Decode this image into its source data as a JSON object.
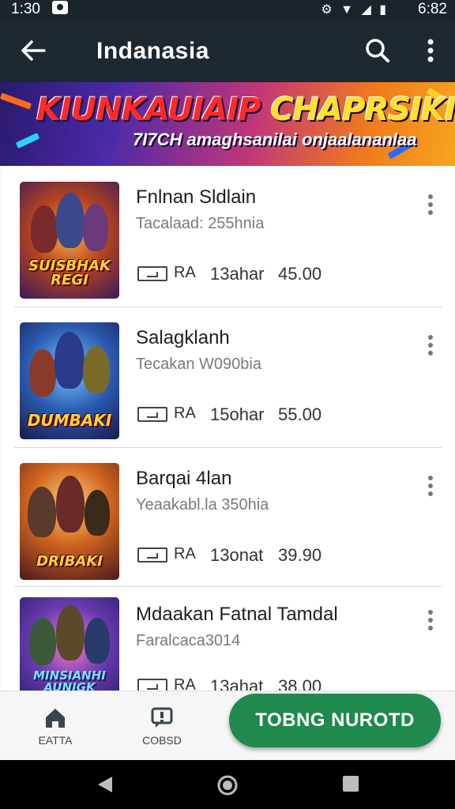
{
  "status_bar": {
    "time": "1:30",
    "system_icons": "⚙ ▼ ◢ ▮",
    "battery_time": "6:82"
  },
  "app_bar": {
    "title": "Indanasia"
  },
  "banner": {
    "headline_red": "KIUNKAUIAIP ",
    "headline_yellow": "CHAPRSIKI",
    "subline": "7I7CH amaghsanilai onjaalananlaa"
  },
  "items": [
    {
      "name": "Fnlnan Sldlain",
      "subtitle": "Tacalaad: 255hnia",
      "age": "RA",
      "duration": "13ahar",
      "price": "45.00",
      "thumb_logo": "SUISBHAK REGI"
    },
    {
      "name": "Salagklanh",
      "subtitle": "Tecakan W090bia",
      "age": "RA",
      "duration": "15ohar",
      "price": "55.00",
      "thumb_logo": "DUMBAKI"
    },
    {
      "name": "Barqai 4lan",
      "subtitle": "Yeaakabl.la 350hia",
      "age": "RA",
      "duration": "13onat",
      "price": "39.90",
      "thumb_logo": "DRIBAKI"
    },
    {
      "name": "Mdaakan Fatnal Tamdal",
      "subtitle": "Faralcaca3014",
      "age": "RA",
      "duration": "13ahat",
      "price": "38.00",
      "thumb_logo": "MINSIANHI AUNIGK"
    }
  ],
  "bottom_nav": {
    "home_label": "EATTA",
    "second_label": "COBSD",
    "cta_label": "TOBNG NUROTD"
  },
  "colors": {
    "app_bar": "#1e2830",
    "cta": "#1f8a4c"
  }
}
